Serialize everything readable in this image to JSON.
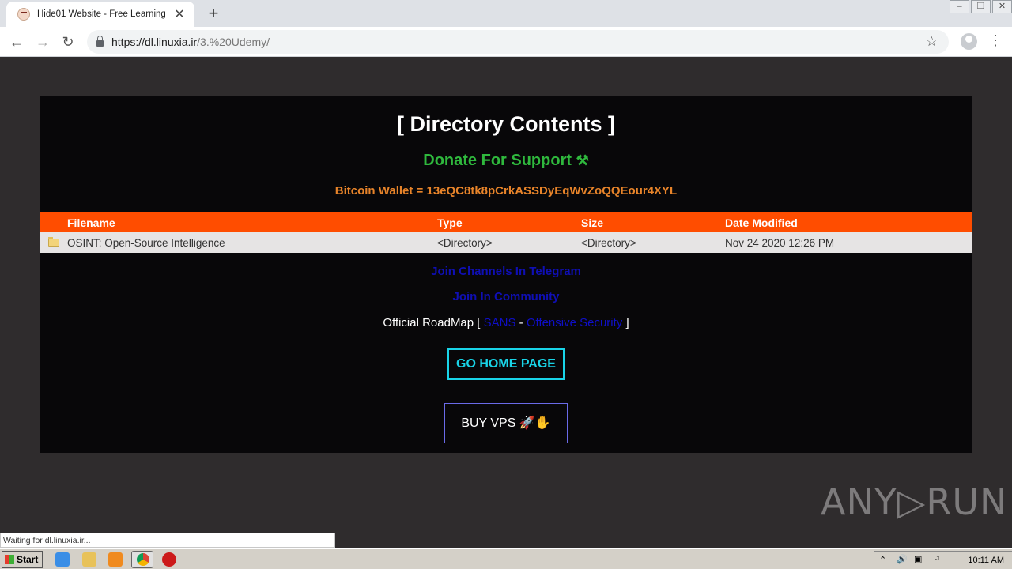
{
  "browser": {
    "tab_title": "Hide01 Website - Free Learning",
    "url_host": "https://dl.linuxia.ir",
    "url_path": "/3.%20Udemy/"
  },
  "page": {
    "heading": "[ Directory Contents ]",
    "donate": "Donate For Support",
    "wallet": "Bitcoin Wallet = 13eQC8tk8pCrkASSDyEqWvZoQQEour4XYL",
    "table": {
      "headers": [
        "Filename",
        "Type",
        "Size",
        "Date Modified"
      ],
      "rows": [
        [
          "OSINT: Open-Source Intelligence",
          "<Directory>",
          "<Directory>",
          "Nov 24 2020 12:26 PM"
        ]
      ]
    },
    "telegram_link": "Join Channels In Telegram",
    "community_link": "Join In Community",
    "roadmap_prefix": "Official RoadMap [",
    "roadmap_sans": "SANS",
    "roadmap_sep": "-",
    "roadmap_offsec": "Offensive Security",
    "roadmap_suffix": "]",
    "go_home": "GO HOME PAGE",
    "buy_vps": "BUY VPS"
  },
  "status_text": "Waiting for dl.linuxia.ir...",
  "watermark": "ANY▷RUN",
  "taskbar": {
    "start": "Start",
    "clock": "10:11 AM"
  },
  "colors": {
    "accent_orange": "#ff4d00",
    "donate_green": "#2fb83d",
    "wallet_orange": "#e8842a",
    "home_cyan": "#19d4e8"
  }
}
